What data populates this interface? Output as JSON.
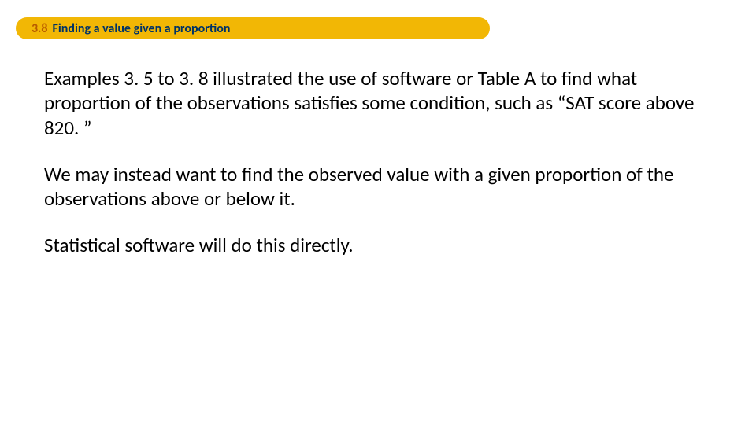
{
  "header": {
    "number": "3.8",
    "title": "Finding a value given a proportion"
  },
  "paragraphs": {
    "p1": "Examples 3. 5 to 3. 8 illustrated the use of software or Table A to find what proportion of the observations satisfies some condition, such as “SAT score above 820. ”",
    "p2": " We may instead want to find the observed value with a given proportion of the observations above or below it.",
    "p3": "Statistical software will do this directly."
  }
}
